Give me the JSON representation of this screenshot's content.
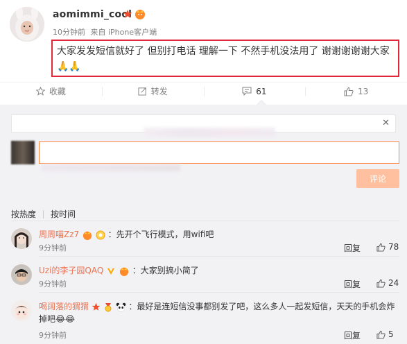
{
  "post": {
    "username": "aomimmi_cool",
    "time": "10分钟前",
    "source": "来自 iPhone客户端",
    "content": "大家发发短信就好了 但别打电话 理解一下 不然手机没法用了 谢谢谢谢谢大家🙏🙏"
  },
  "actions": {
    "favorite_label": "收藏",
    "repost_label": "转发",
    "comment_count": "61",
    "like_count": "13"
  },
  "composer": {
    "submit_label": "评论"
  },
  "sort": {
    "hot_label": "按热度",
    "time_label": "按时间"
  },
  "comments": [
    {
      "user": "周周喵Zz7",
      "text": "：先开个飞行模式，用wifi吧",
      "time": "9分钟前",
      "reply_label": "回复",
      "likes": "78"
    },
    {
      "user": "Uzi的李子园QAQ",
      "text": "：大家别搞小简了",
      "time": "9分钟前",
      "reply_label": "回复",
      "likes": "24"
    },
    {
      "user": "喝阔落的猬猬",
      "text": "：最好是连短信没事都别发了吧，这么多人一起发短信，天天的手机会炸掉吧😂😂",
      "time": "9分钟前",
      "reply_label": "回复",
      "likes": "5"
    }
  ],
  "colors": {
    "highlight_border": "#e0283a",
    "username_orange": "#eb7350",
    "input_border": "#ff8140",
    "submit_bg": "#ffc09f"
  }
}
